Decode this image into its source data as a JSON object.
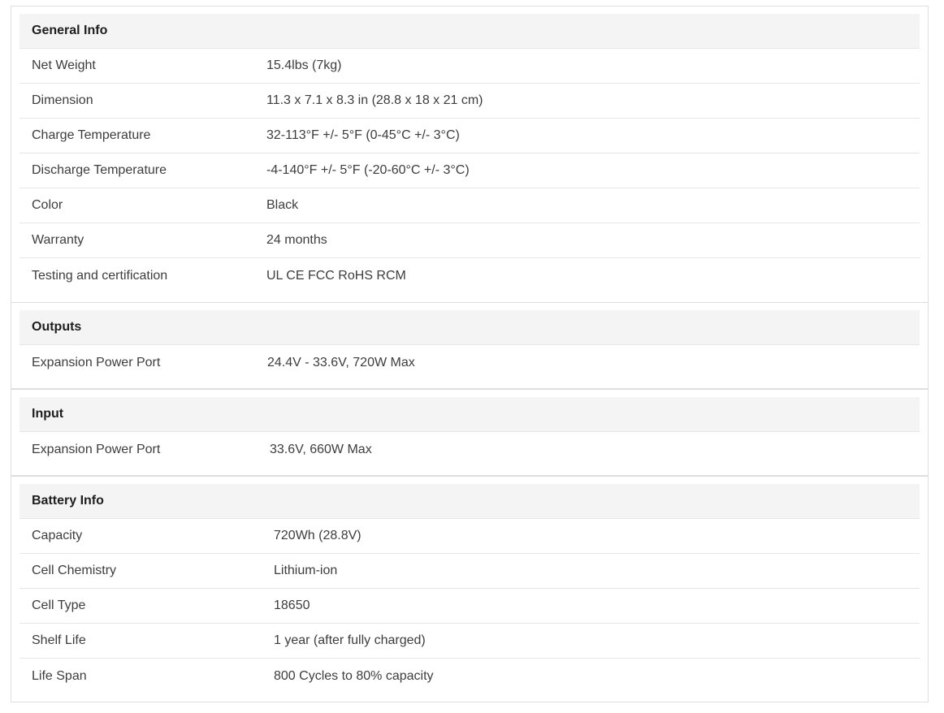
{
  "sections": [
    {
      "title": "General Info",
      "rows": [
        {
          "label": "Net Weight",
          "value": "15.4lbs (7kg)"
        },
        {
          "label": "Dimension",
          "value": "11.3 x 7.1 x 8.3 in (28.8 x 18 x 21 cm)"
        },
        {
          "label": "Charge Temperature",
          "value": "32-113°F +/- 5°F (0-45°C +/- 3°C)"
        },
        {
          "label": "Discharge Temperature",
          "value": "-4-140°F +/- 5°F (-20-60°C +/- 3°C)"
        },
        {
          "label": "Color",
          "value": "Black"
        },
        {
          "label": "Warranty",
          "value": "24 months"
        },
        {
          "label": "Testing and certification",
          "value": "UL CE FCC RoHS RCM"
        }
      ]
    },
    {
      "title": "Outputs",
      "rows": [
        {
          "label": "Expansion Power Port",
          "value": "24.4V - 33.6V, 720W Max"
        }
      ]
    },
    {
      "title": "Input",
      "rows": [
        {
          "label": "Expansion Power Port",
          "value": "33.6V, 660W Max"
        }
      ]
    },
    {
      "title": "Battery Info",
      "rows": [
        {
          "label": "Capacity",
          "value": "720Wh (28.8V)"
        },
        {
          "label": "Cell Chemistry",
          "value": "Lithium-ion"
        },
        {
          "label": "Cell Type",
          "value": "18650"
        },
        {
          "label": "Shelf Life",
          "value": "1 year (after fully charged)"
        },
        {
          "label": "Life Span",
          "value": "800 Cycles to 80% capacity"
        }
      ]
    }
  ]
}
